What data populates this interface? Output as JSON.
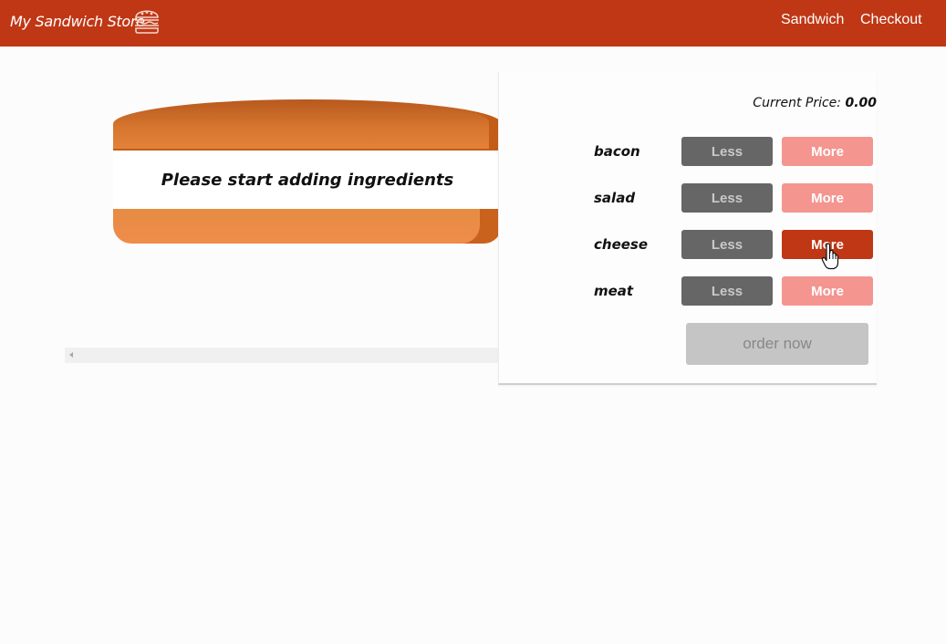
{
  "header": {
    "brand": "My Sandwich Store",
    "logo_icon": "burger-icon",
    "nav": [
      {
        "label": "Sandwich"
      },
      {
        "label": "Checkout"
      }
    ]
  },
  "preview": {
    "message": "Please start adding ingredients"
  },
  "controls": {
    "price_label": "Current Price:",
    "price_value": "0.00",
    "ingredients": [
      {
        "label": "bacon",
        "less": "Less",
        "more": "More"
      },
      {
        "label": "salad",
        "less": "Less",
        "more": "More"
      },
      {
        "label": "cheese",
        "less": "Less",
        "more": "More"
      },
      {
        "label": "meat",
        "less": "Less",
        "more": "More"
      }
    ],
    "order_button": "order now"
  },
  "colors": {
    "brand": "#bf3715",
    "less_button": "#666666",
    "more_button": "#f49590",
    "more_button_hover": "#bf3715",
    "disabled_button": "#c5c5c5"
  }
}
